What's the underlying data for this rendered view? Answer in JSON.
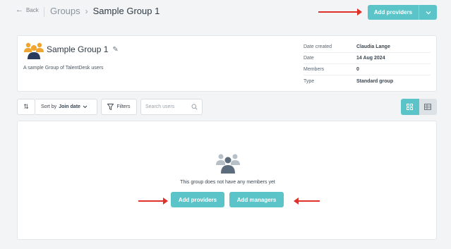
{
  "header": {
    "back_label": "Back",
    "breadcrumb_parent": "Groups",
    "breadcrumb_current": "Sample Group 1",
    "add_providers_label": "Add providers"
  },
  "group": {
    "name": "Sample Group 1",
    "description": "A sample Group of TalentDesk users",
    "meta": [
      {
        "key": "Date created",
        "value": "Claudia Lange"
      },
      {
        "key": "Date",
        "value": "14 Aug 2024"
      },
      {
        "key": "Members",
        "value": "0"
      },
      {
        "key": "Type",
        "value": "Standard group"
      }
    ]
  },
  "toolbar": {
    "sort_prefix": "Sort by",
    "sort_value": "Join date",
    "filters_label": "Filters",
    "search_placeholder": "Search users"
  },
  "members": {
    "empty_text": "This group does not have any members yet",
    "add_providers_label": "Add providers",
    "add_managers_label": "Add managers"
  },
  "colors": {
    "accent": "#5bc4c9",
    "annotation_arrow": "#e0302a",
    "icon_orange": "#f0a532",
    "icon_navy": "#2a3a5c"
  }
}
